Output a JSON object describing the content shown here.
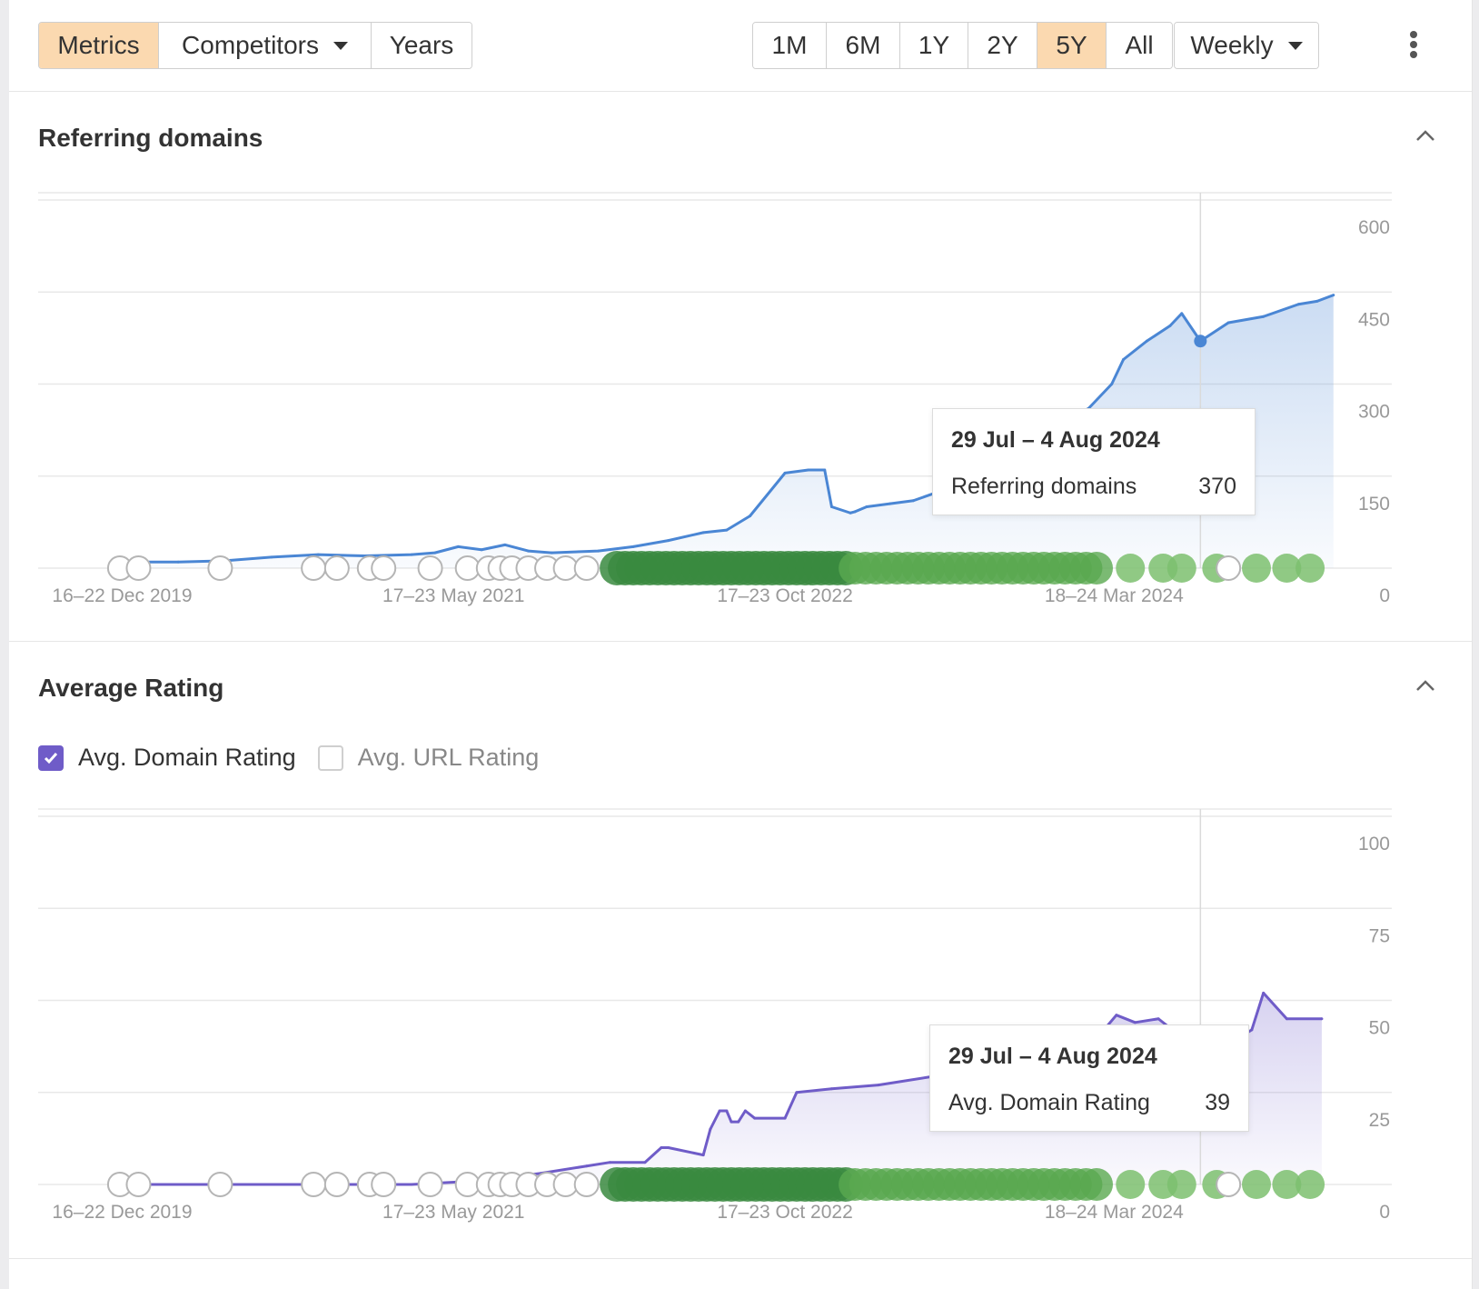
{
  "toolbar": {
    "view_tabs": [
      {
        "label": "Metrics",
        "active": true
      },
      {
        "label": "Competitors",
        "dropdown": true
      },
      {
        "label": "Years"
      }
    ],
    "ranges": [
      {
        "label": "1M"
      },
      {
        "label": "6M"
      },
      {
        "label": "1Y"
      },
      {
        "label": "2Y"
      },
      {
        "label": "5Y",
        "active": true
      },
      {
        "label": "All"
      }
    ],
    "interval": "Weekly",
    "active_color": "#fbd9b0"
  },
  "sections": {
    "referring": {
      "title": "Referring domains"
    },
    "rating": {
      "title": "Average Rating",
      "options": [
        {
          "label": "Avg. Domain Rating",
          "checked": true
        },
        {
          "label": "Avg. URL Rating",
          "checked": false
        }
      ]
    }
  },
  "tooltips": {
    "referring": {
      "date": "29 Jul – 4 Aug 2024",
      "label": "Referring domains",
      "value": "370"
    },
    "rating": {
      "date": "29 Jul – 4 Aug 2024",
      "label": "Avg. Domain Rating",
      "value": "39"
    }
  },
  "chart_data": [
    {
      "type": "area",
      "title": "Referring domains",
      "line_color": "#4a86d4",
      "x_ticks": [
        {
          "label": "16–22 Dec 2019",
          "x": 2019.96
        },
        {
          "label": "17–23 May 2021",
          "x": 2021.38
        },
        {
          "label": "17–23 Oct 2022",
          "x": 2022.8
        },
        {
          "label": "18–24 Mar 2024",
          "x": 2024.21
        }
      ],
      "xlim": [
        2019.6,
        2025.4
      ],
      "ylim": [
        0,
        600
      ],
      "y_ticks": [
        0,
        150,
        300,
        450,
        600
      ],
      "grid": true,
      "highlight": {
        "x": 2024.58,
        "y": 370
      },
      "x": [
        2019.96,
        2020.2,
        2020.4,
        2020.6,
        2020.8,
        2021.0,
        2021.2,
        2021.3,
        2021.4,
        2021.5,
        2021.6,
        2021.7,
        2021.8,
        2022.0,
        2022.15,
        2022.3,
        2022.45,
        2022.55,
        2022.65,
        2022.8,
        2022.9,
        2022.97,
        2023.0,
        2023.08,
        2023.1,
        2023.15,
        2023.25,
        2023.35,
        2023.5,
        2023.6,
        2023.75,
        2023.9,
        2024.0,
        2024.1,
        2024.2,
        2024.25,
        2024.35,
        2024.45,
        2024.5,
        2024.58,
        2024.7,
        2024.85,
        2025.0,
        2025.08,
        2025.15
      ],
      "values": [
        10,
        10,
        12,
        18,
        22,
        20,
        22,
        25,
        35,
        30,
        38,
        28,
        25,
        28,
        35,
        45,
        58,
        62,
        85,
        155,
        160,
        160,
        100,
        90,
        92,
        100,
        105,
        110,
        130,
        150,
        175,
        210,
        240,
        260,
        300,
        340,
        370,
        395,
        415,
        370,
        400,
        410,
        430,
        435,
        445
      ]
    },
    {
      "type": "line",
      "title": "Average Rating",
      "line_color": "#6f5cc8",
      "series": [
        {
          "name": "Avg. Domain Rating"
        }
      ],
      "x_ticks": [
        {
          "label": "16–22 Dec 2019",
          "x": 2019.96
        },
        {
          "label": "17–23 May 2021",
          "x": 2021.38
        },
        {
          "label": "17–23 Oct 2022",
          "x": 2022.8
        },
        {
          "label": "18–24 Mar 2024",
          "x": 2024.21
        }
      ],
      "xlim": [
        2019.6,
        2025.4
      ],
      "ylim": [
        0,
        100
      ],
      "y_ticks": [
        0,
        25,
        50,
        75,
        100
      ],
      "grid": true,
      "highlight": {
        "x": 2024.58,
        "y": 39
      },
      "x": [
        2019.96,
        2020.4,
        2020.8,
        2021.2,
        2021.5,
        2021.75,
        2021.95,
        2022.05,
        2022.2,
        2022.27,
        2022.3,
        2022.45,
        2022.48,
        2022.52,
        2022.55,
        2022.57,
        2022.6,
        2022.63,
        2022.67,
        2022.8,
        2022.85,
        2023.0,
        2023.2,
        2023.5,
        2023.8,
        2024.1,
        2024.22,
        2024.3,
        2024.4,
        2024.5,
        2024.58,
        2024.62,
        2024.75,
        2024.8,
        2024.85,
        2024.95,
        2025.1
      ],
      "values": [
        0,
        0,
        0,
        0,
        1,
        3,
        5,
        6,
        6,
        10,
        10,
        8,
        15,
        20,
        20,
        17,
        17,
        20,
        18,
        18,
        25,
        26,
        27,
        30,
        33,
        37,
        46,
        44,
        45,
        40,
        39,
        40,
        40,
        42,
        52,
        45,
        45
      ]
    }
  ]
}
